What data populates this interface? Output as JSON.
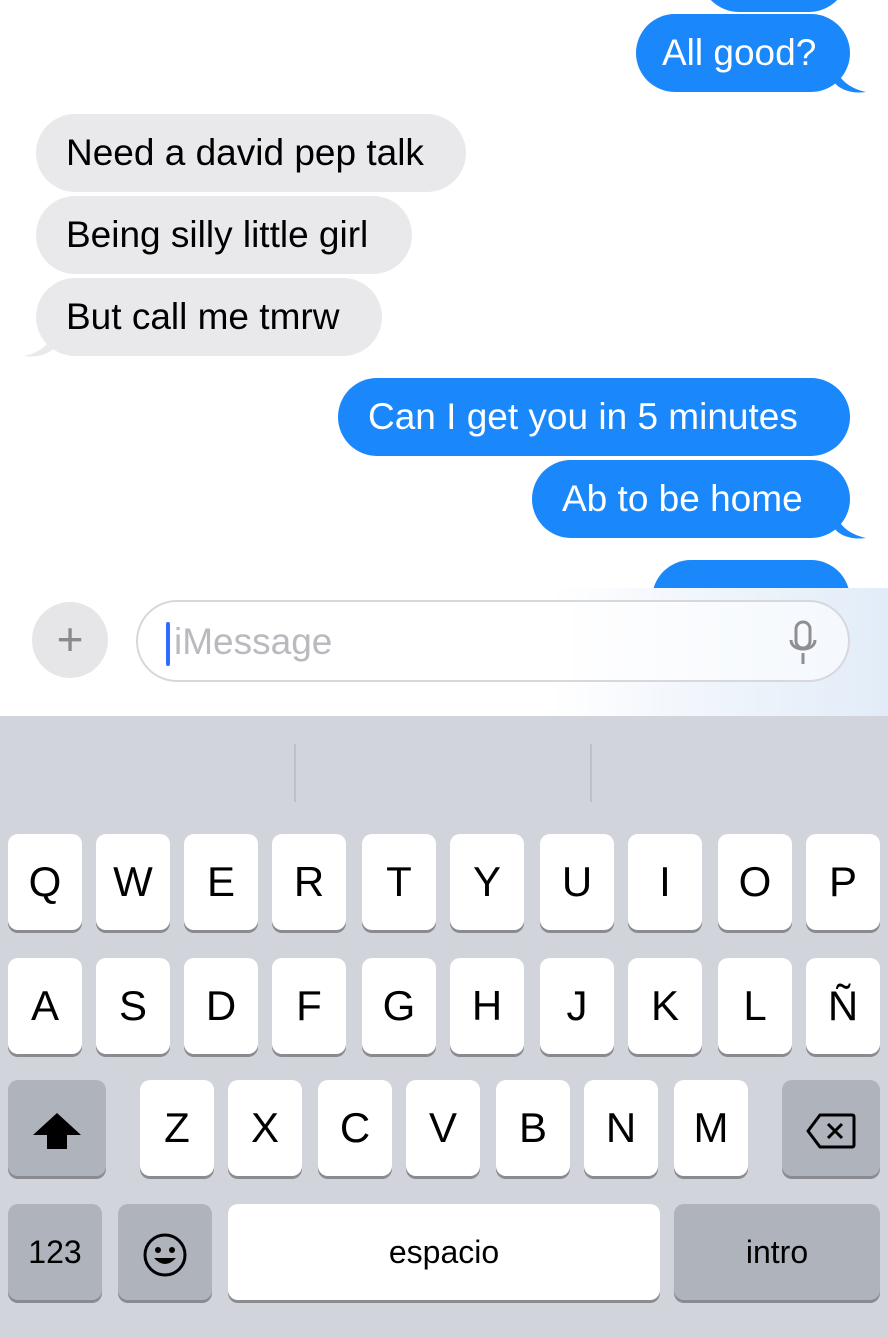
{
  "messages": [
    {
      "id": "out-partial-top",
      "direction": "outgoing",
      "text": ""
    },
    {
      "id": "out-1",
      "direction": "outgoing",
      "text": "All good?"
    },
    {
      "id": "in-1",
      "direction": "incoming",
      "text": "Need a david pep talk"
    },
    {
      "id": "in-2",
      "direction": "incoming",
      "text": "Being silly little girl"
    },
    {
      "id": "in-3",
      "direction": "incoming",
      "text": "But call me tmrw"
    },
    {
      "id": "out-2",
      "direction": "outgoing",
      "text": "Can I get you in 5 minutes"
    },
    {
      "id": "out-3",
      "direction": "outgoing",
      "text": "Ab to be home"
    },
    {
      "id": "out-partial-bottom",
      "direction": "outgoing",
      "text": ""
    }
  ],
  "composer": {
    "plus_label": "+",
    "placeholder": "iMessage",
    "mic_icon": "microphone-icon"
  },
  "keyboard": {
    "row1": [
      "Q",
      "W",
      "E",
      "R",
      "T",
      "Y",
      "U",
      "I",
      "O",
      "P"
    ],
    "row2": [
      "A",
      "S",
      "D",
      "F",
      "G",
      "H",
      "J",
      "K",
      "L",
      "Ñ"
    ],
    "row3": [
      "Z",
      "X",
      "C",
      "V",
      "B",
      "N",
      "M"
    ],
    "shift_icon": "shift-arrow-icon",
    "delete_icon": "backspace-icon",
    "numbers_label": "123",
    "emoji_icon": "emoji-icon",
    "space_label": "espacio",
    "return_label": "intro"
  },
  "colors": {
    "outgoing_bubble": "#1a87fb",
    "incoming_bubble": "#e9e9eb",
    "keyboard_bg": "#d1d4db",
    "key_bg": "#ffffff",
    "special_key_bg": "#aeb3bc"
  }
}
